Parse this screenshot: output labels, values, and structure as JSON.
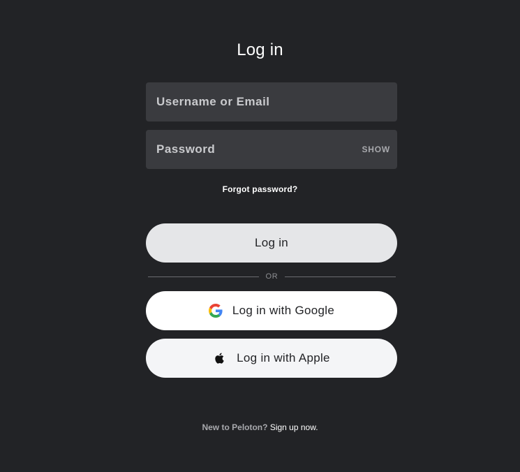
{
  "page": {
    "title": "Log in"
  },
  "form": {
    "username_placeholder": "Username or Email",
    "username_value": "",
    "password_placeholder": "Password",
    "password_value": "",
    "show_label": "SHOW",
    "forgot_label": "Forgot password?",
    "login_label": "Log in",
    "divider_label": "OR"
  },
  "social": {
    "google_label": "Log in with Google",
    "google_icon": "google-g-icon",
    "apple_label": "Log in with Apple",
    "apple_icon": "apple-logo-icon"
  },
  "footer": {
    "prompt": "New to Peloton?",
    "signup_label": "Sign up now."
  },
  "colors": {
    "background": "#222326",
    "field_background": "#3a3b3f",
    "primary_button": "#e5e6e8",
    "google_button": "#ffffff",
    "apple_button": "#f4f5f7"
  }
}
